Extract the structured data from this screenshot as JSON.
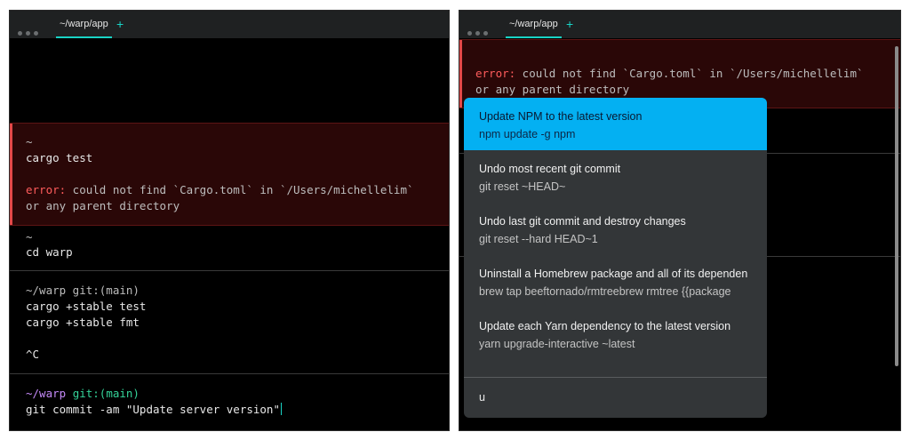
{
  "left_window": {
    "tab_label": "~/warp/app",
    "new_tab_symbol": "+",
    "blocks": [
      {
        "prompt": "~",
        "command": "cargo test",
        "error_label": "error:",
        "error_text": " could not find `Cargo.toml` in `/Users/michellelim`",
        "error_text2": "or any parent directory"
      },
      {
        "prompt": "~",
        "command": "cd warp"
      },
      {
        "prompt": "~/warp git:(main)",
        "command1": "cargo +stable test",
        "command2": "cargo +stable fmt",
        "interrupt": "^C"
      }
    ],
    "active_prompt_dir": "~/warp",
    "active_prompt_git": "git:(main)",
    "active_command": "git commit -am \"Update server version\""
  },
  "right_window": {
    "tab_label": "~/warp/app",
    "new_tab_symbol": "+",
    "error_label": "error:",
    "error_text": " could not find `Cargo.toml` in `/Users/michellelim`",
    "error_text2": "or any parent directory",
    "menu": {
      "items": [
        {
          "title": "Update NPM to the latest version",
          "command": "npm update -g npm",
          "selected": true
        },
        {
          "title": "Undo most recent git commit",
          "command": "git reset ~HEAD~"
        },
        {
          "title": "Undo last git commit and destroy changes",
          "command": "git reset --hard HEAD~1"
        },
        {
          "title": "Uninstall a Homebrew package and all of its dependen",
          "command": "brew tap beeftornado/rmtreebrew rmtree {{package"
        },
        {
          "title": "Update each Yarn dependency to the latest version",
          "command": "yarn upgrade-interactive ~latest"
        }
      ],
      "input_value": "u"
    }
  },
  "colors": {
    "accent": "#19d3c5",
    "selection": "#04b0f2",
    "error": "#ff5c5c",
    "error_bg": "#2a0707",
    "git_purple": "#c58af9",
    "git_green": "#34d399"
  }
}
